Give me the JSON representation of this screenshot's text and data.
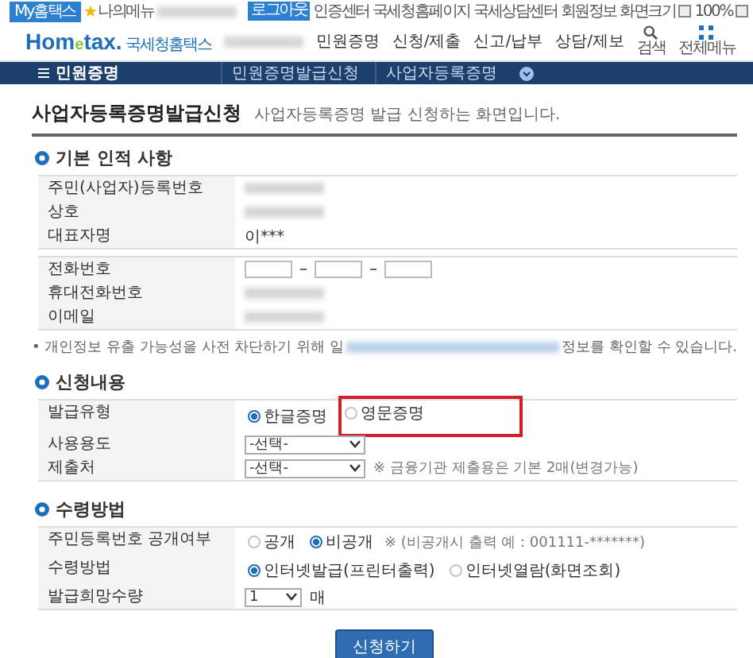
{
  "top_bar": {
    "my_button": "My홈택스",
    "my_menu": "나의메뉴",
    "logout": "로그아웃",
    "links": [
      "인증센터",
      "국세청홈페이지",
      "국세상담센터",
      "회원정보",
      "화면크기"
    ],
    "zoom": "100%"
  },
  "header": {
    "logo": "Hom",
    "logo_e": "e",
    "logo_tax": "tax.",
    "logo_sub": "국세청홈택스",
    "nav": [
      "민원증명",
      "신청/제출",
      "신고/납부",
      "상담/제보"
    ],
    "search": "검색",
    "all_menu": "전체메뉴"
  },
  "breadcrumb": {
    "menu": "민원증명",
    "items": [
      "민원증명발급신청",
      "사업자등록증명"
    ]
  },
  "page": {
    "title": "사업자등록증명발급신청",
    "subtitle": "사업자등록증명 발급 신청하는 화면입니다."
  },
  "basic_info": {
    "heading": "기본 인적 사항",
    "rows": [
      {
        "label": "주민(사업자)등록번호",
        "kind": "blurred"
      },
      {
        "label": "상호",
        "kind": "blurred"
      },
      {
        "label": "대표자명",
        "kind": "text",
        "value": "이***"
      }
    ],
    "contact_rows": [
      {
        "label": "전화번호",
        "kind": "phone"
      },
      {
        "label": "휴대전화번호",
        "kind": "blurred"
      },
      {
        "label": "이메일",
        "kind": "blurred"
      }
    ],
    "note_start": "• 개인정보 유출 가능성을 사전 차단하기 위해 일",
    "note_end": "정보를 확인할 수 있습니다."
  },
  "application": {
    "heading": "신청내용",
    "rows": [
      {
        "label": "발급유형",
        "kind": "radio",
        "options": [
          {
            "label": "한글증명",
            "selected": true,
            "highlighted": false
          },
          {
            "label": "영문증명",
            "selected": false,
            "highlighted": true
          }
        ]
      },
      {
        "label": "사용용도",
        "kind": "select",
        "value": "-선택-"
      },
      {
        "label": "제출처",
        "kind": "select",
        "value": "-선택-",
        "hint": "※ 금융기관 제출용은 기본 2매(변경가능)"
      }
    ]
  },
  "receipt": {
    "heading": "수령방법",
    "rows": [
      {
        "label": "주민등록번호 공개여부",
        "kind": "radio",
        "options": [
          {
            "label": "공개",
            "selected": false,
            "highlighted": false
          },
          {
            "label": "비공개",
            "selected": true,
            "highlighted": false
          }
        ],
        "hint": "※ (비공개시 출력 예 : 001111-*******)"
      },
      {
        "label": "수령방법",
        "kind": "radio",
        "options": [
          {
            "label": "인터넷발급(프린터출력)",
            "selected": true,
            "highlighted": false
          },
          {
            "label": "인터넷열람(화면조회)",
            "selected": false,
            "highlighted": false
          }
        ]
      },
      {
        "label": "발급희망수량",
        "kind": "qty",
        "value": "1",
        "unit": "매"
      }
    ]
  },
  "submit": "신청하기"
}
